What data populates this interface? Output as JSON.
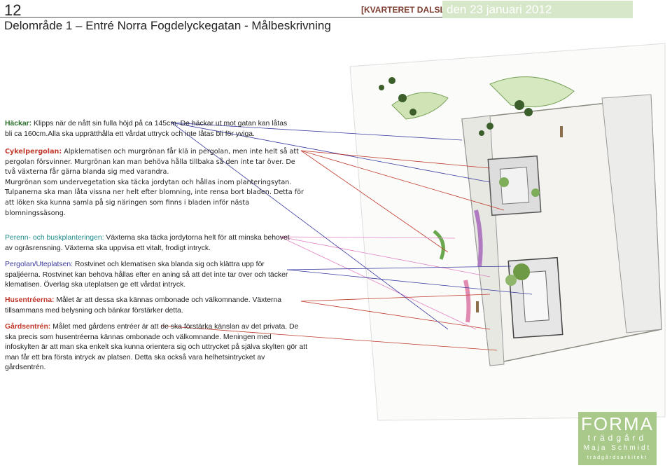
{
  "header": {
    "page_number": "12",
    "title": "Delområde 1 – Entré Norra Fogdelyckegatan - Målbeskrivning",
    "project": "[KVARTERET DALSLAND]",
    "date": "den 23 januari 2012"
  },
  "sections": {
    "hackar": {
      "label": "Häckar:",
      "text": " Klipps när de nått sin fulla höjd på ca 145cm. De häckar ut mot gatan kan låtas bli ca 160cm.Alla  ska upprätthålla ett vårdat uttryck och inte låtas bli för yviga."
    },
    "cykelpergolan": {
      "label": "Cykelpergolan:",
      "text": " Alpklematisen och murgrönan får klä in pergolan, men inte helt så att pergolan försvinner. Murgrönan kan man behöva hålla tillbaka så den inte tar över. De två växterna får gärna blanda sig med varandra.",
      "text2": "Murgrönan som undervegetation ska täcka jordytan och hållas inom planteringsytan. Tulpanerna ska man låta vissna ner helt efter blomning, inte rensa bort bladen. Detta för att löken ska kunna samla på sig näringen som finns i bladen inför nästa blomningssäsong."
    },
    "perenn": {
      "label": "Perenn- och buskplanteringen:",
      "text": " Växterna ska täcka jordytorna helt för att minska behovet av ogräsrensning. Växterna ska uppvisa ett vitalt, frodigt intryck."
    },
    "pergolan": {
      "label": "Pergolan/Uteplatsen:",
      "text": " Rostvinet och klematisen ska blanda sig och klättra upp för spaljéerna. Rostvinet kan behöva hållas efter en aning så att det inte tar över och täcker klematisen. Överlag ska uteplatsen ge ett vårdat intryck."
    },
    "husentre": {
      "label": "Husentréerna:",
      "text": " Målet är att dessa ska kännas ombonade och välkomnande. Växterna tillsammans med belysning och bänkar förstärker detta."
    },
    "gardsentren": {
      "label": "Gårdsentrén:",
      "text": " Målet med gårdens entréer är att de ska förstärka känslan av det privata. De ska precis som husentréerna kännas ombonade och välkomnande. Meningen med infoskylten är att man ska enkelt ska kunna orientera sig och uttrycket på själva skylten gör att man får ett bra första intryck av platsen. Detta ska också vara helhetsintrycket av gårdsentrén."
    }
  },
  "logo": {
    "forma": "FORMA",
    "tradgard": "trädgård",
    "name": "Maja Schmidt",
    "role": "trädgårdsarkitekt"
  },
  "colors": {
    "date_bg": "#d7e7c9",
    "logo_bg": "#a8c98a",
    "project": "#7b3d2f",
    "label_green": "#2c6e2c",
    "label_red": "#c0392b"
  }
}
